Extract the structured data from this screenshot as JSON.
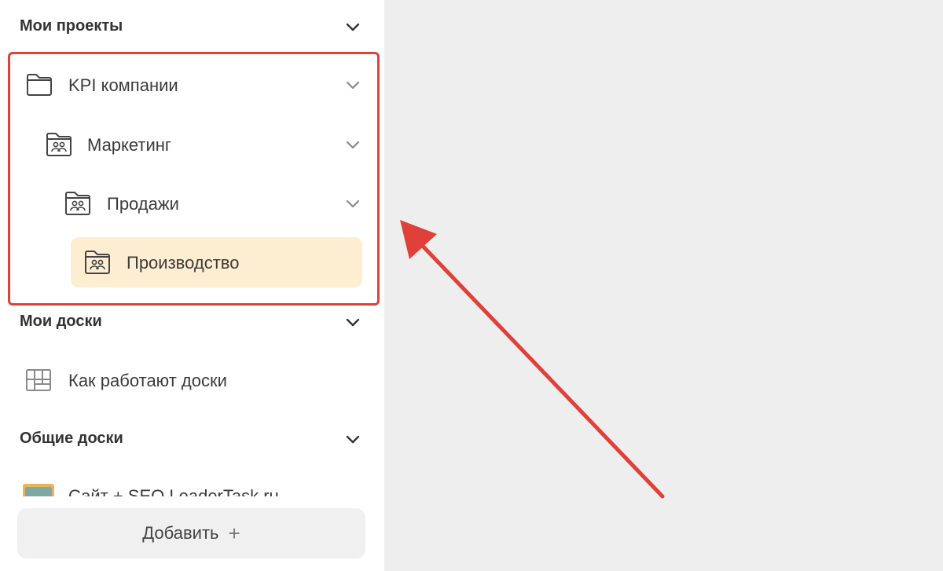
{
  "sidebar": {
    "my_projects": {
      "title": "Мои проекты",
      "items": [
        {
          "label": "KPI компании",
          "icon": "folder-icon"
        },
        {
          "label": "Маркетинг",
          "icon": "team-folder-icon"
        },
        {
          "label": "Продажи",
          "icon": "team-folder-icon"
        },
        {
          "label": "Производство",
          "icon": "team-folder-icon",
          "selected": true
        }
      ]
    },
    "my_boards": {
      "title": "Мои доски",
      "items": [
        {
          "label": "Как работают доски",
          "icon": "board-grid-icon"
        }
      ]
    },
    "shared_boards": {
      "title": "Общие доски",
      "items": [
        {
          "label": "Сайт + SEO LeaderTask.ru",
          "icon": "board-thumbnail-icon"
        }
      ]
    },
    "add_button": {
      "label": "Добавить",
      "plus": "+"
    }
  },
  "colors": {
    "highlight_frame": "#e0403a",
    "arrow": "#e0403a",
    "selected_background": "#fdedd1",
    "canvas_background": "#efeeef"
  }
}
